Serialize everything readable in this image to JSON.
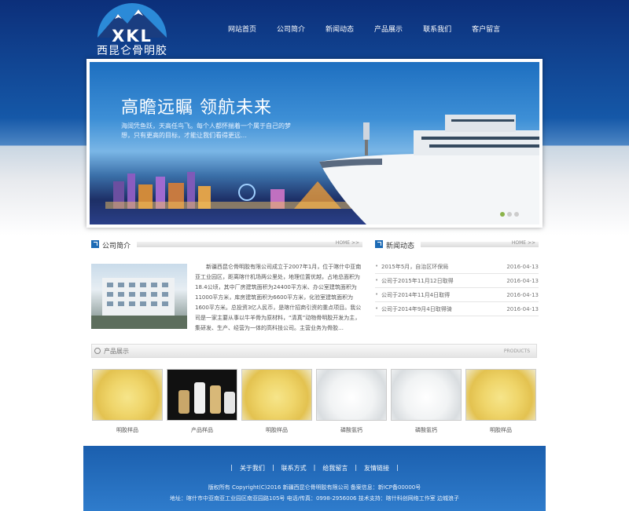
{
  "logo": {
    "mark": "XKL",
    "name": "西昆仑骨明胶"
  },
  "nav": [
    "网站首页",
    "公司简介",
    "新闻动态",
    "产品展示",
    "联系我们",
    "客户留言"
  ],
  "banner": {
    "title": "高瞻远瞩 领航未来",
    "subtitle": "海阔凭鱼跃，天高任鸟飞。每个人都怀揣着一个属于自己的梦想，只有更高的目标，才能让我们看得更远…"
  },
  "about": {
    "title": "公司简介",
    "more": "HOME >>",
    "text": "新疆西昆仑骨明胶有限公司成立于2007年1月，位于喀什中亚南亚工业园区，距离喀什机场两公里处，地理位置优越，占地总面积为18.4公顷，其中厂房建筑面积为24400平方米、办公室建筑面积为11000平方米，库房建筑面积为6600平方米，化验室建筑面积为1600平方米。总投资3亿人民币，是喀什招商引资的重点项目。我公司是一家主要从事以牛羊骨为原材料，“清真”动物骨明胶开发为主，集研发、生产、经营为一体的高科技公司。主营业务为骨胶…"
  },
  "news": {
    "title": "新闻动态",
    "more": "HOME >>",
    "items": [
      {
        "title": "2015年5月，自治区环保局",
        "date": "2016-04-13"
      },
      {
        "title": "公司于2015年11月12日取得",
        "date": "2016-04-13"
      },
      {
        "title": "公司于2014年11月4日取得",
        "date": "2016-04-13"
      },
      {
        "title": "公司于2014年9月4日取得骑",
        "date": "2016-04-13"
      }
    ]
  },
  "products": {
    "title": "产品展示",
    "more": "PRODUCTS",
    "items": [
      {
        "caption": "明胶样品",
        "image": "gelatin-granules"
      },
      {
        "caption": "产品样品",
        "image": "sample-bottles"
      },
      {
        "caption": "明胶样品",
        "image": "gelatin-granules"
      },
      {
        "caption": "磷酸氢钙",
        "image": "white-powder"
      },
      {
        "caption": "磷酸氢钙",
        "image": "white-powder"
      },
      {
        "caption": "明胶样品",
        "image": "gelatin-granules"
      }
    ]
  },
  "footer": {
    "links": [
      "关于我们",
      "联系方式",
      "给我留言",
      "友情链接"
    ],
    "copyright": "版权所有 Copyright(C)2016 新疆西昆仑骨明胶有限公司 备案信息：新ICP备00000号",
    "address": "地址：喀什市中亚南亚工业园区南亚园路105号 电话/传真：0998-2956006 技术支持：喀什科创网络工作室 边城浪子"
  }
}
